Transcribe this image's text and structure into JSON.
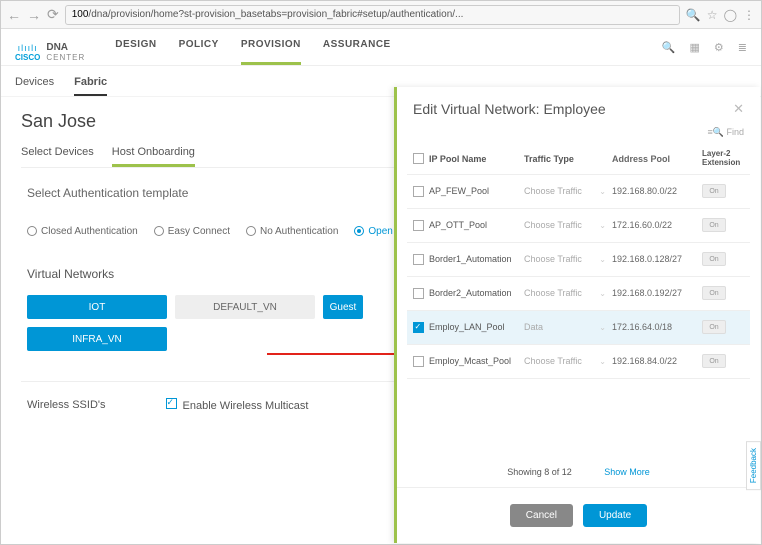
{
  "chrome": {
    "url_prefix": "100",
    "url_rest": "/dna/provision/home?st-provision_basetabs=provision_fabric#setup/authentication/..."
  },
  "brand": {
    "cisco": "CISCO",
    "dna": "DNA",
    "center": "CENTER"
  },
  "nav": {
    "design": "DESIGN",
    "policy": "POLICY",
    "provision": "PROVISION",
    "assurance": "ASSURANCE"
  },
  "subnav": {
    "devices": "Devices",
    "fabric": "Fabric"
  },
  "site": "San Jose",
  "subnav2": {
    "select": "Select Devices",
    "host": "Host Onboarding"
  },
  "auth": {
    "title": "Select Authentication template",
    "closed": "Closed Authentication",
    "easy": "Easy Connect",
    "none": "No Authentication",
    "open": "Open Authent"
  },
  "vn": {
    "title": "Virtual Networks",
    "iot": "IOT",
    "default": "DEFAULT_VN",
    "guest": "Guest",
    "infra": "INFRA_VN"
  },
  "ssid": {
    "title": "Wireless SSID's",
    "enable": "Enable Wireless Multicast"
  },
  "panel": {
    "title": "Edit Virtual Network: Employee",
    "find": "Find",
    "cols": {
      "name": "IP Pool Name",
      "type": "Traffic Type",
      "addr": "Address Pool",
      "ext": "Layer-2 Extension"
    },
    "rows": [
      {
        "name": "AP_FEW_Pool",
        "type": "Choose Traffic",
        "addr": "192.168.80.0/22",
        "on": "On",
        "sel": false
      },
      {
        "name": "AP_OTT_Pool",
        "type": "Choose Traffic",
        "addr": "172.16.60.0/22",
        "on": "On",
        "sel": false
      },
      {
        "name": "Border1_Automation",
        "type": "Choose Traffic",
        "addr": "192.168.0.128/27",
        "on": "On",
        "sel": false
      },
      {
        "name": "Border2_Automation",
        "type": "Choose Traffic",
        "addr": "192.168.0.192/27",
        "on": "On",
        "sel": false
      },
      {
        "name": "Employ_LAN_Pool",
        "type": "Data",
        "addr": "172.16.64.0/18",
        "on": "On",
        "sel": true
      },
      {
        "name": "Employ_Mcast_Pool",
        "type": "Choose Traffic",
        "addr": "192.168.84.0/22",
        "on": "On",
        "sel": false
      }
    ],
    "showing": "Showing 8 of 12",
    "more": "Show More",
    "cancel": "Cancel",
    "update": "Update"
  },
  "feedback": "Feedback"
}
